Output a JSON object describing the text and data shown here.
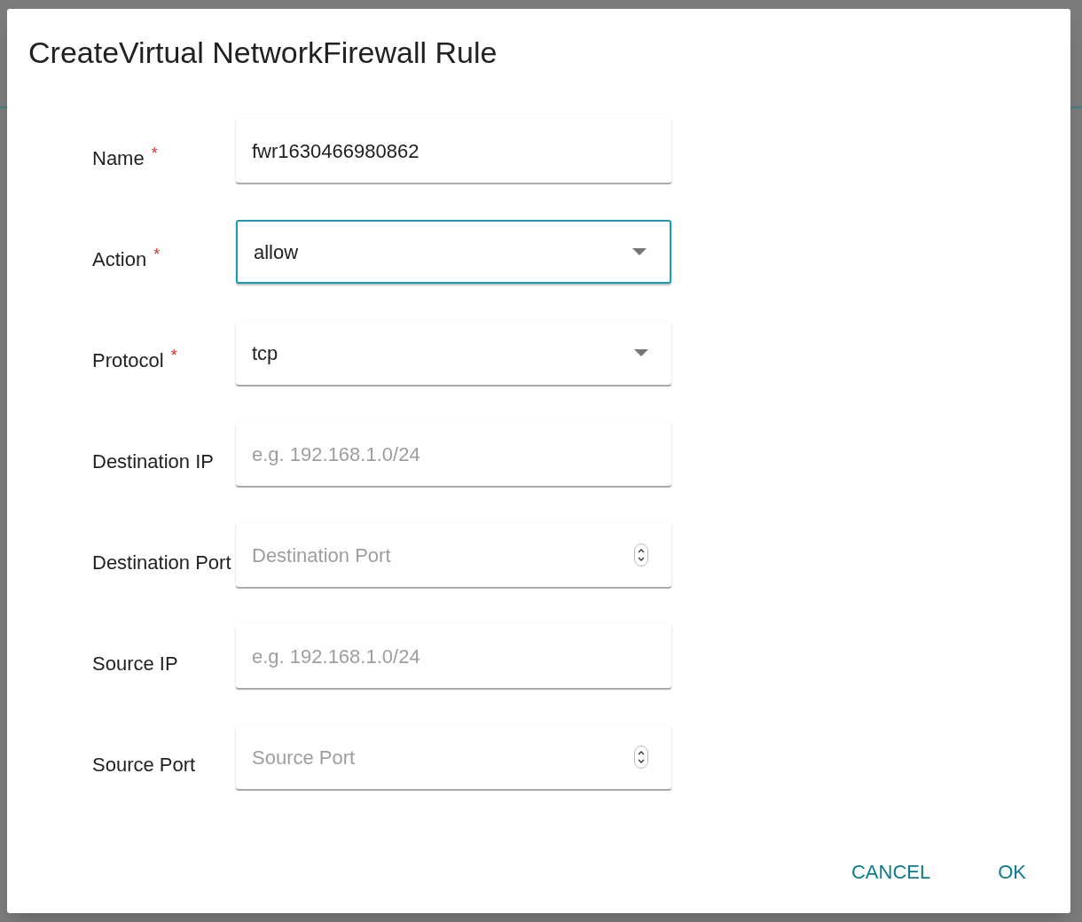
{
  "dialog": {
    "title": "CreateVirtual NetworkFirewall Rule",
    "fields": [
      {
        "label": "Name",
        "required_mark": "*",
        "kind": "text",
        "value": "fwr1630466980862",
        "focused": false
      },
      {
        "label": "Action",
        "required_mark": "*",
        "kind": "select",
        "value": "allow",
        "focused": true
      },
      {
        "label": "Protocol",
        "required_mark": "*",
        "kind": "select",
        "value": "tcp",
        "focused": false
      },
      {
        "label": "Destination IP",
        "kind": "text",
        "placeholder": "e.g. 192.168.1.0/24",
        "focused": false
      },
      {
        "label": "Destination Port",
        "kind": "number",
        "placeholder": "Destination Port",
        "focused": false
      },
      {
        "label": "Source IP",
        "kind": "text",
        "placeholder": "e.g. 192.168.1.0/24",
        "focused": false
      },
      {
        "label": "Source Port",
        "kind": "number",
        "placeholder": "Source Port",
        "focused": false
      }
    ],
    "buttons": [
      "CANCEL",
      "OK"
    ]
  }
}
